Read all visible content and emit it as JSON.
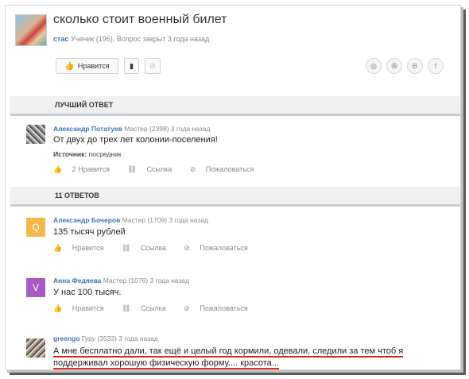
{
  "question": {
    "title": "сколько стоит военный билет",
    "user": "стас",
    "meta": "Ученик (196), Вопрос закрыт 3 года назад",
    "like_label": "Нравится"
  },
  "social": [
    "◎",
    "✇",
    "В",
    "f"
  ],
  "best": {
    "section_label": "ЛУЧШИЙ ОТВЕТ",
    "author": "Александр Потатуев",
    "meta": "Мастер (2398) 3 года назад",
    "text": "От двух до трех лет колонии-поселения!",
    "source_label": "Источник:",
    "source": "посредник",
    "likes": "2 Нравится",
    "link": "Ссылка",
    "report": "Пожаловаться"
  },
  "answers_label": "11 ОТВЕТОВ",
  "answers": [
    {
      "author": "Александр Бочеров",
      "meta": "Мастер (1709) 3 года назад",
      "text": "135 тысяч рублей",
      "like": "Нравится",
      "link": "Ссылка",
      "report": "Пожаловаться",
      "avatar_letter": "Q"
    },
    {
      "author": "Анна Федяева",
      "meta": "Мастер (1076) 3 года назад",
      "text": "У нас 100 тысяч.",
      "like": "Нравится",
      "link": "Ссылка",
      "report": "Пожаловаться",
      "avatar_letter": "V"
    },
    {
      "author": "greengo",
      "meta": "Гуру (3533) 3 года назад",
      "text": "А мне бесплатно дали, так ещё и целый год кормили, одевали, следили за тем чтоб я поддерживал хорошую физическую форму.... красота..."
    }
  ]
}
